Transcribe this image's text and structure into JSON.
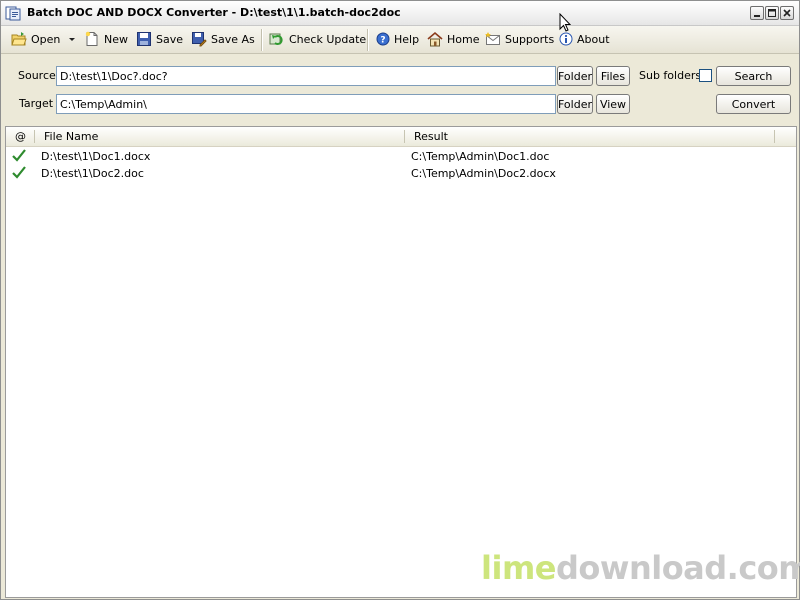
{
  "window": {
    "title": "Batch DOC AND DOCX Converter - D:\\test\\1\\1.batch-doc2doc"
  },
  "toolbar": {
    "open_label": "Open",
    "new_label": "New",
    "save_label": "Save",
    "save_as_label": "Save As",
    "check_update_label": "Check Update",
    "help_label": "Help",
    "home_label": "Home",
    "supports_label": "Supports",
    "about_label": "About"
  },
  "source": {
    "label": "Source",
    "value": "D:\\test\\1\\Doc?.doc?",
    "folder_button": "Folder",
    "files_button": "Files"
  },
  "subfolders": {
    "label": "Sub folders",
    "checked": false
  },
  "search_button": "Search",
  "target": {
    "label": "Target",
    "value": "C:\\Temp\\Admin\\",
    "folder_button": "Folder",
    "view_button": "View"
  },
  "convert_button": "Convert",
  "list": {
    "columns": [
      "@",
      "File Name",
      "Result"
    ],
    "rows": [
      {
        "status": "done",
        "file": "D:\\test\\1\\Doc1.docx",
        "result": "C:\\Temp\\Admin\\Doc1.doc"
      },
      {
        "status": "done",
        "file": "D:\\test\\1\\Doc2.doc",
        "result": "C:\\Temp\\Admin\\Doc2.docx"
      }
    ]
  },
  "watermark": {
    "part1": "lime",
    "part2": "download.com"
  },
  "colors": {
    "check_green": "#2e8b2e",
    "watermark_lime": "#cde57d",
    "watermark_gray": "#c9c9c9"
  }
}
